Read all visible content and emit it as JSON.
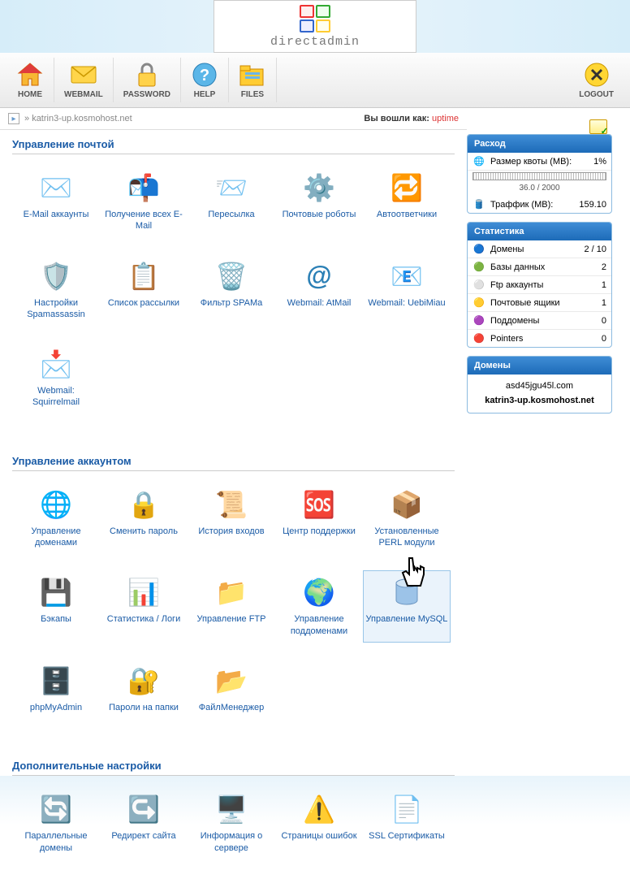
{
  "brand": "directadmin",
  "toolbar": {
    "home": "HOME",
    "webmail": "WEBMAIL",
    "password": "PASSWORD",
    "help": "HELP",
    "files": "FILES",
    "logout": "LOGOUT"
  },
  "breadcrumb": {
    "arrow": "»",
    "domain": "katrin3-up.kosmohost.net",
    "login_as_prefix": "Вы вошли как:",
    "login_user": "uptime"
  },
  "sections": {
    "mail_title": "Управление почтой",
    "account_title": "Управление аккаунтом",
    "extra_title": "Дополнительные настройки"
  },
  "mail_items": [
    {
      "label": "E-Mail аккаунты"
    },
    {
      "label": "Получение всех E-Mail"
    },
    {
      "label": "Пересылка"
    },
    {
      "label": "Почтовые роботы"
    },
    {
      "label": "Автоответчики"
    },
    {
      "label": "Настройки Spamassassin"
    },
    {
      "label": "Список рассылки"
    },
    {
      "label": "Фильтр SPAMа"
    },
    {
      "label": "Webmail: AtMail"
    },
    {
      "label": "Webmail: UebiMiau"
    },
    {
      "label": "Webmail: Squirrelmail"
    }
  ],
  "account_items": [
    {
      "label": "Управление доменами"
    },
    {
      "label": "Сменить пароль"
    },
    {
      "label": "История входов"
    },
    {
      "label": "Центр поддержки"
    },
    {
      "label": "Установленные PERL модули"
    },
    {
      "label": "Бэкапы"
    },
    {
      "label": "Статистика / Логи"
    },
    {
      "label": "Управление FTP"
    },
    {
      "label": "Управление поддоменами"
    },
    {
      "label": "Управление MySQL"
    },
    {
      "label": "phpMyAdmin"
    },
    {
      "label": "Пароли на папки"
    },
    {
      "label": "ФайлМенеджер"
    }
  ],
  "extra_items": [
    {
      "label": "Параллельные домены"
    },
    {
      "label": "Редирект сайта"
    },
    {
      "label": "Информация о сервере"
    },
    {
      "label": "Страницы ошибок"
    },
    {
      "label": "SSL Сертификаты"
    }
  ],
  "sidebar": {
    "usage_title": "Расход",
    "quota_label": "Размер квоты (MB):",
    "quota_pct": "1%",
    "quota_text": "36.0 / 2000",
    "traffic_label": "Траффик (MB):",
    "traffic_val": "159.10",
    "stats_title": "Статистика",
    "stats": [
      {
        "label": "Домены",
        "val": "2 / 10"
      },
      {
        "label": "Базы данных",
        "val": "2"
      },
      {
        "label": "Ftp аккаунты",
        "val": "1"
      },
      {
        "label": "Почтовые ящики",
        "val": "1"
      },
      {
        "label": "Поддомены",
        "val": "0"
      },
      {
        "label": "Pointers",
        "val": "0"
      }
    ],
    "domains_title": "Домены",
    "domains": [
      "asd45jgu45l.com",
      "katrin3-up.kosmohost.net"
    ]
  }
}
